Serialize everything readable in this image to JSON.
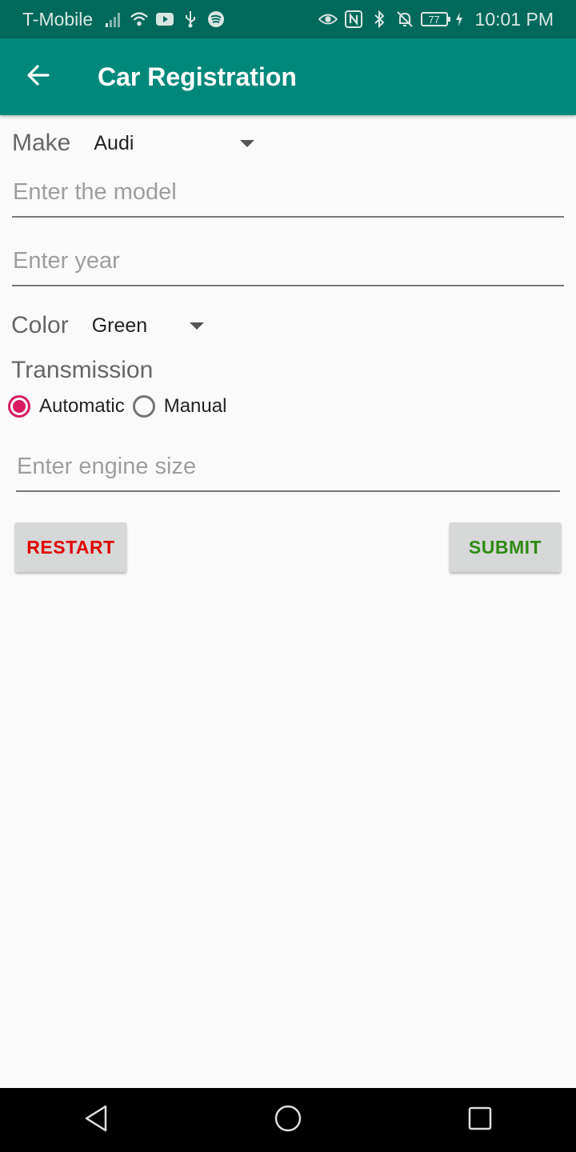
{
  "status_bar": {
    "carrier": "T-Mobile",
    "battery": "77",
    "time": "10:01 PM"
  },
  "app_bar": {
    "title": "Car Registration"
  },
  "form": {
    "make": {
      "label": "Make",
      "value": "Audi"
    },
    "model": {
      "placeholder": "Enter the model",
      "value": ""
    },
    "year": {
      "placeholder": "Enter year",
      "value": ""
    },
    "color": {
      "label": "Color",
      "value": "Green"
    },
    "transmission": {
      "label": "Transmission",
      "options": [
        {
          "label": "Automatic",
          "checked": true
        },
        {
          "label": "Manual",
          "checked": false
        }
      ]
    },
    "engine_size": {
      "placeholder": "Enter engine size",
      "value": ""
    },
    "restart_label": "RESTART",
    "submit_label": "SUBMIT"
  },
  "colors": {
    "status_bar": "#00695c",
    "app_bar": "#00897b",
    "radio_accent": "#d81b60",
    "restart_text": "#e00000",
    "submit_text": "#2e8b13"
  }
}
